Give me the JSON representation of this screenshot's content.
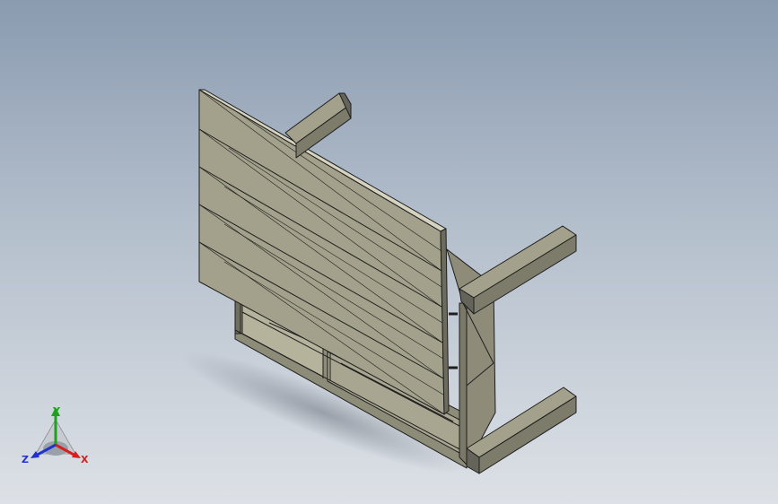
{
  "viewport": {
    "background_top": "#8a9bb0",
    "background_bottom": "#dde1e6"
  },
  "model": {
    "face_color": "#a3a18b",
    "edge_color": "#1e1e1e",
    "shadow_color": "#7d8590"
  },
  "triad": {
    "x_label": "X",
    "y_label": "Y",
    "z_label": "Z",
    "x_color": "#d81e1e",
    "y_color": "#1fa01f",
    "z_color": "#2233cc"
  }
}
